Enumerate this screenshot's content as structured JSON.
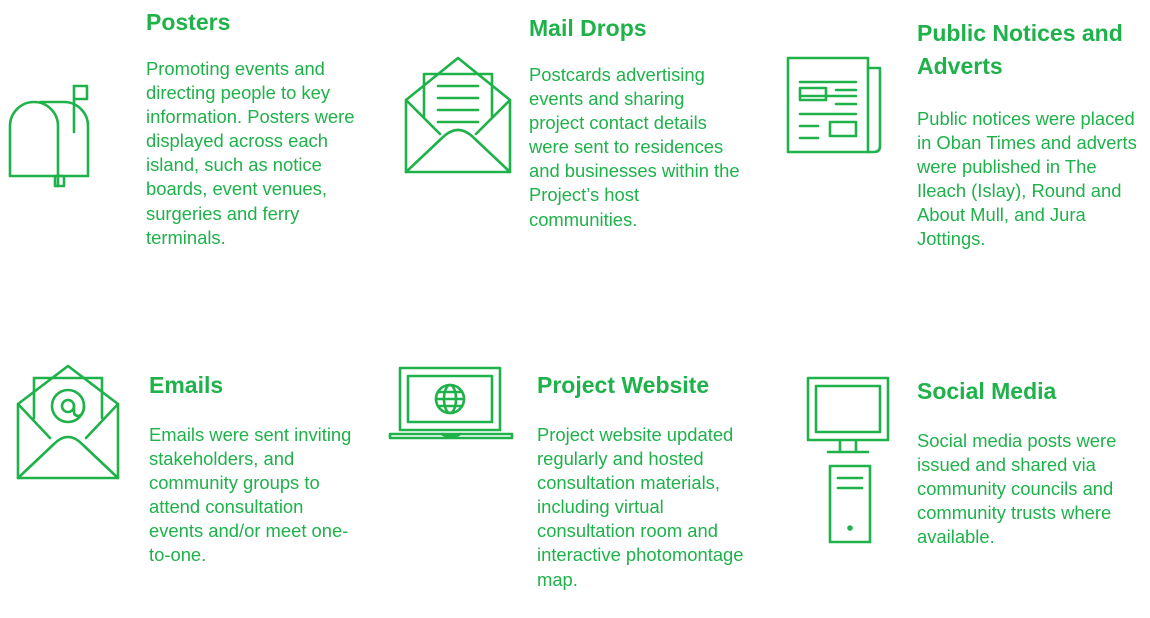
{
  "accent_color": "#1fb14a",
  "items": [
    {
      "icon": "mailbox-icon",
      "title": "Posters",
      "text": "Promoting events and directing people to key information. Posters were displayed across each island, such as notice boards, event venues, surgeries and ferry terminals."
    },
    {
      "icon": "envelope-letter-icon",
      "title": "Mail Drops",
      "text": "Postcards advertising events and sharing project contact details were sent to residences and businesses within the Project’s host communities."
    },
    {
      "icon": "newspaper-icon",
      "title": "Public Notices and Adverts",
      "text": "Public notices were placed in Oban Times and adverts were published in The Ileach (Islay), Round and About Mull, and Jura Jottings."
    },
    {
      "icon": "email-at-icon",
      "title": "Emails",
      "text": "Emails were sent inviting stakeholders, and community groups to attend consultation events and/or meet one-to-one."
    },
    {
      "icon": "laptop-globe-icon",
      "title": "Project Website",
      "text": "Project website updated regularly and hosted consultation materials, including virtual consultation room and interactive photomontage map."
    },
    {
      "icon": "desktop-computer-icon",
      "title": "Social Media",
      "text": "Social media posts were issued and shared via community councils and community trusts where available."
    }
  ]
}
